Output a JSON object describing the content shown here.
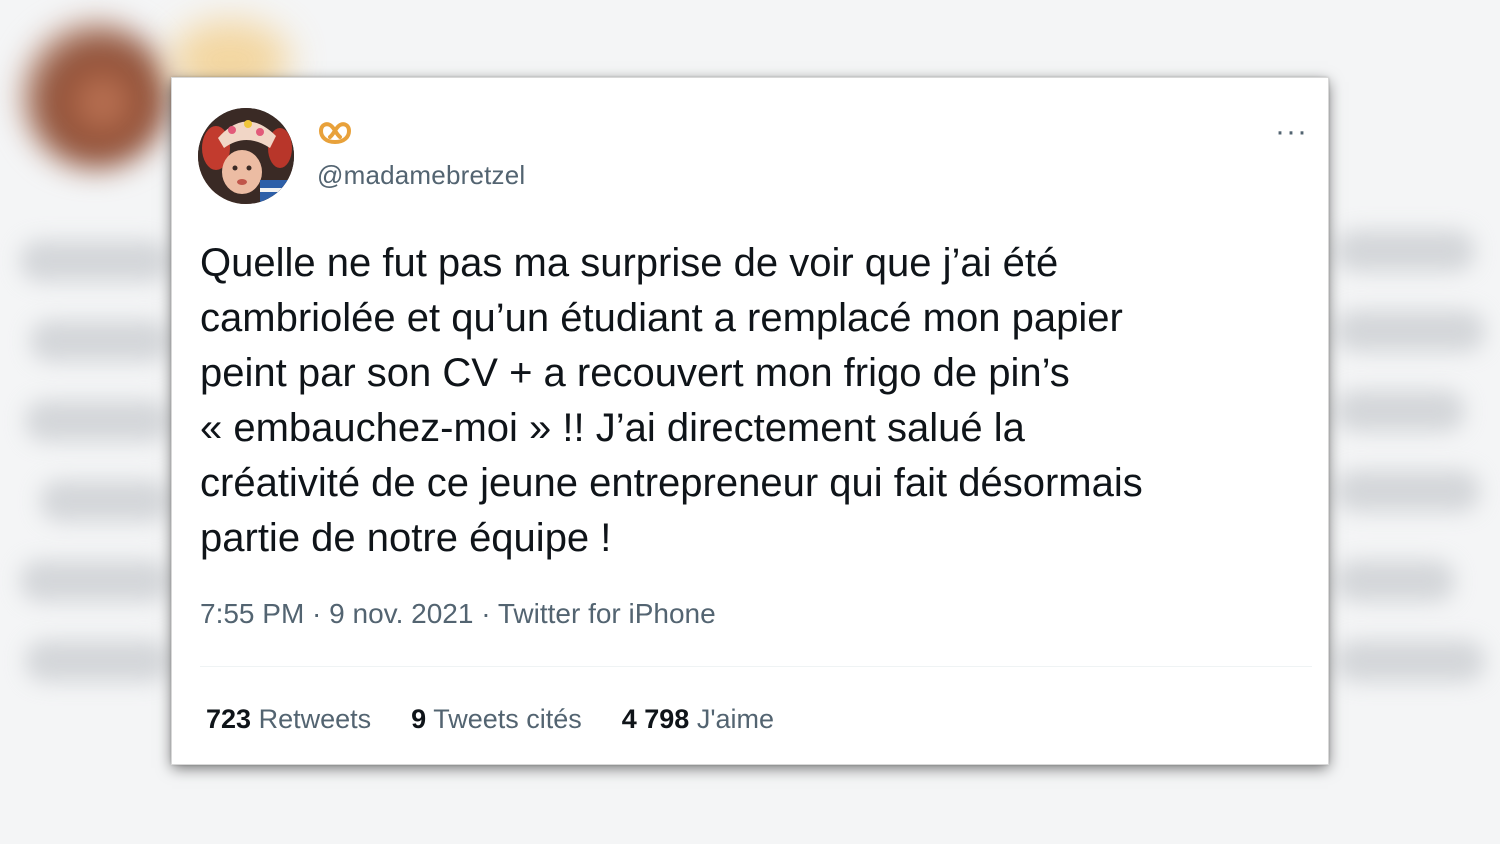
{
  "tweet": {
    "handle": "@madamebretzel",
    "text": "Quelle ne fut pas ma surprise de voir que j’ai été\ncambriolée et qu’un étudiant a remplacé mon papier\npeint par son CV + a recouvert mon frigo de pin’s\n« embauchez-moi » !! J’ai directement salué la\ncréativité de ce jeune entrepreneur qui fait désormais\npartie de notre équipe !",
    "time": "7:55 PM",
    "separator1": " · ",
    "date": "9 nov. 2021",
    "separator2": " · ",
    "source": "Twitter for iPhone",
    "more_label": "···",
    "name_icon": "pretzel-icon"
  },
  "stats": {
    "retweets": {
      "count": "723",
      "label": "Retweets"
    },
    "quotes": {
      "count": "9",
      "label": "Tweets cités"
    },
    "likes": {
      "count": "4 798",
      "label": "J'aime"
    }
  },
  "colors": {
    "text": "#0f1419",
    "secondary": "#536471",
    "pretzel": "#e8a13a"
  }
}
